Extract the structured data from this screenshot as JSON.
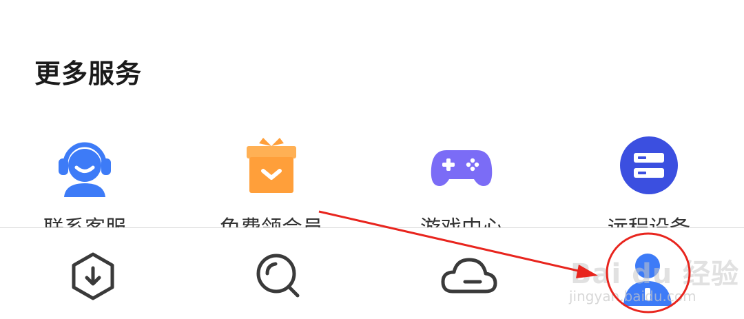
{
  "section": {
    "title": "更多服务"
  },
  "services": [
    {
      "label": "联系客服",
      "icon": "headset-agent-icon",
      "color": "#3D7BF7"
    },
    {
      "label": "免费领会员",
      "icon": "gift-box-icon",
      "color": "#FF9F3A"
    },
    {
      "label": "游戏中心",
      "icon": "gamepad-icon",
      "color": "#7B6CF6"
    },
    {
      "label": "远程设备",
      "icon": "server-icon",
      "color": "#3B4FE0"
    }
  ],
  "tabbar": {
    "items": [
      {
        "icon": "download-hexagon-icon"
      },
      {
        "icon": "search-magnifier-icon"
      },
      {
        "icon": "cloud-icon"
      },
      {
        "icon": "profile-avatar-icon",
        "active": true,
        "color": "#3D7BF7"
      }
    ]
  },
  "annotation": {
    "arrow_color": "#E8251E",
    "circle_color": "#E8251E"
  },
  "watermark": {
    "main": "Bai du 经验",
    "sub": "jingyan.baidu.com"
  }
}
